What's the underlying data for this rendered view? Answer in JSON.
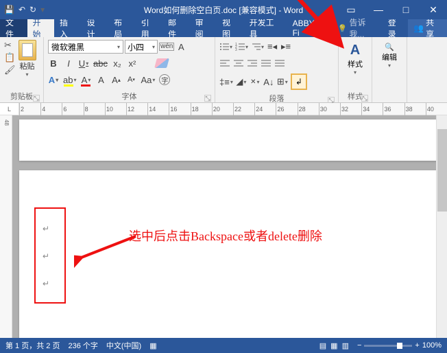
{
  "title": "Word如何删除空白页.doc [兼容模式] - Word",
  "tabs": {
    "file": "文件",
    "home": "开始",
    "insert": "插入",
    "design": "设计",
    "layout": "布局",
    "references": "引用",
    "mailings": "邮件",
    "review": "审阅",
    "view": "视图",
    "developer": "开发工具",
    "abbyy": "ABBYY Fi"
  },
  "tell_me": "告诉我...",
  "login": "登录",
  "share": "共享",
  "clipboard": {
    "label": "剪贴板",
    "paste": "粘贴"
  },
  "font": {
    "label": "字体",
    "name": "微软雅黑",
    "size": "小四"
  },
  "paragraph": {
    "label": "段落"
  },
  "styles": {
    "label": "样式"
  },
  "editing": {
    "label": "编辑"
  },
  "ruler_numbers": [
    "2",
    "4",
    "6",
    "8",
    "10",
    "12",
    "14",
    "16",
    "18",
    "20",
    "22",
    "24",
    "26",
    "28",
    "30",
    "32",
    "34",
    "36",
    "38",
    "40"
  ],
  "vruler_numbers": [
    "48"
  ],
  "annotation_text": "选中后点击Backspace或者delete删除",
  "status": {
    "page": "第 1 页，共 2 页",
    "words": "236 个字",
    "lang": "中文(中国)",
    "zoom": "100%"
  }
}
